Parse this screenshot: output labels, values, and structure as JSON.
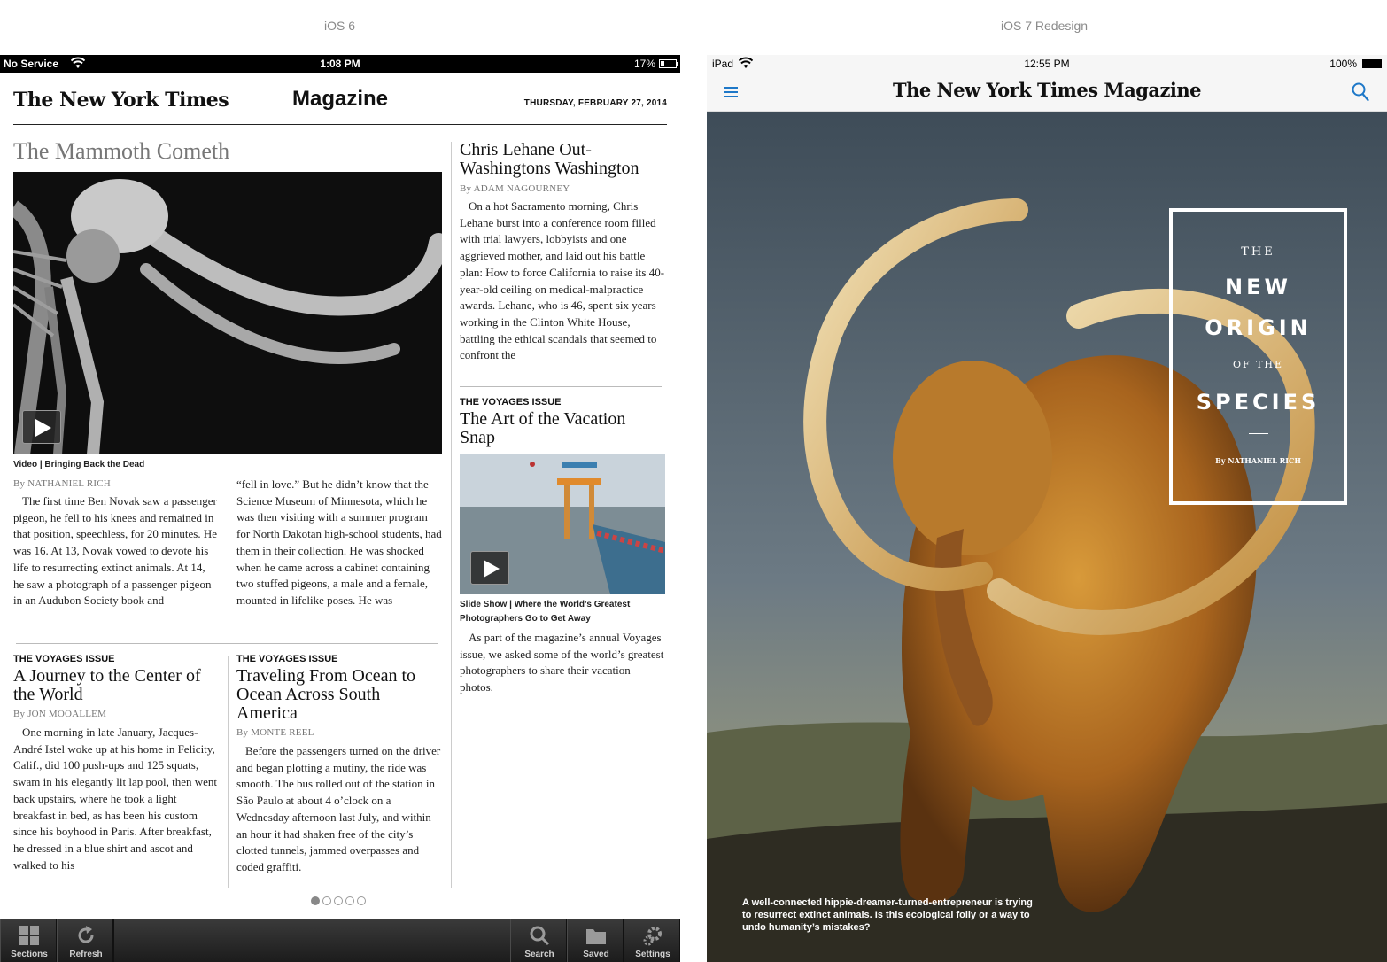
{
  "labels": {
    "left": "iOS 6",
    "right": "iOS 7 Redesign"
  },
  "ios6": {
    "status": {
      "carrier": "No Service",
      "time": "1:08 PM",
      "battery": "17%"
    },
    "header": {
      "logo": "The New York Times",
      "section": "Magazine",
      "date": "THURSDAY, FEBRUARY 27, 2014"
    },
    "lead": {
      "title": "The Mammoth Cometh",
      "media_caption": "Video | Bringing Back the Dead",
      "byline_prefix": "By",
      "byline_name": "NATHANIEL RICH",
      "col1": "The first time Ben Novak saw a passenger pigeon, he fell to his knees and remained in that position, speechless, for 20 minutes. He was 16. At 13, Novak vowed to devote his life to resurrecting extinct animals. At 14, he saw a photograph of a passenger pigeon in an Audubon Society book and",
      "col2": "“fell in love.” But he didn’t know that the Science Museum of Minnesota, which he was then visiting with a summer program for North Dakotan high-school students, had them in their collection. He was shocked when he came across a cabinet containing two stuffed pigeons, a male and a female, mounted in lifelike poses. He was"
    },
    "side1": {
      "title": "Chris Lehane Out-Washingtons Washington",
      "byline_prefix": "By",
      "byline_name": "ADAM NAGOURNEY",
      "body": "On a hot Sacramento morning, Chris Lehane burst into a conference room filled with trial lawyers, lobbyists and one aggrieved mother, and laid out his battle plan: How to force California to raise its 40-year-old ceiling on medical-malpractice awards. Lehane, who is 46, spent six years working in the Clinton White House, battling the ethical scandals that seemed to confront the"
    },
    "side2": {
      "kicker": "THE VOYAGES ISSUE",
      "title": "The Art of the Vacation Snap",
      "media_caption": "Slide Show | Where the World’s Greatest Photographers Go to Get Away",
      "body": "As part of the magazine’s annual Voyages issue, we asked some of the world’s greatest photographers to share their vacation photos."
    },
    "bottom1": {
      "kicker": "THE VOYAGES ISSUE",
      "title": "A Journey to the Center of the World",
      "byline_prefix": "By",
      "byline_name": "JON MOOALLEM",
      "body": "One morning in late January, Jacques-André Istel woke up at his home in Felicity, Calif., did 100 push-ups and 125 squats, swam in his elegantly lit lap pool, then went back upstairs, where he took a light breakfast in bed, as has been his custom since his boyhood in Paris. After breakfast, he dressed in a blue shirt and ascot and walked to his"
    },
    "bottom2": {
      "kicker": "THE VOYAGES ISSUE",
      "title": "Traveling From Ocean to Ocean Across South America",
      "byline_prefix": "By",
      "byline_name": "MONTE REEL",
      "body": "Before the passengers turned on the driver and began plotting a mutiny, the ride was smooth. The bus rolled out of the station in São Paulo at about 4 o’clock on a Wednesday afternoon last July, and within an hour it had shaken free of the city’s clotted tunnels, jammed overpasses and coded graffiti."
    },
    "pager": {
      "current": 1,
      "total": 5
    },
    "toolbar": {
      "sections": "Sections",
      "refresh": "Refresh",
      "search": "Search",
      "saved": "Saved",
      "settings": "Settings"
    }
  },
  "ios7": {
    "status": {
      "device": "iPad",
      "time": "12:55 PM",
      "battery": "100%"
    },
    "nav": {
      "logo": "The New York Times Magazine"
    },
    "cover": {
      "line1": "THE",
      "line2": "NEW",
      "line3": "ORIGIN",
      "line4": "OF THE",
      "line5": "SPECIES",
      "byline": "By NATHANIEL RICH",
      "caption": "A well-connected hippie-dreamer-turned-entrepreneur is trying to resurrect extinct animals. Is this ecological folly or a way to undo humanity’s mistakes?"
    }
  },
  "colors": {
    "ios7_accent": "#1e78c8",
    "toolbar": "#2a2a2a"
  }
}
